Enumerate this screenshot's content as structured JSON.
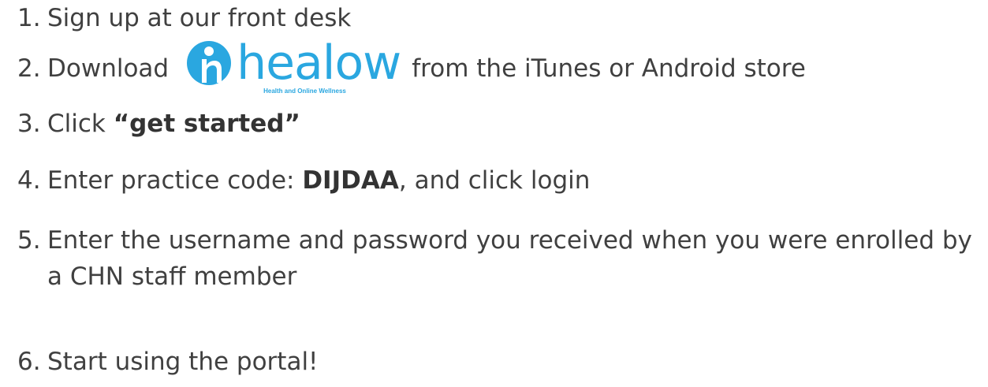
{
  "steps": [
    {
      "num": "1.",
      "text": "Sign up at our front desk"
    },
    {
      "num": "2.",
      "before": "Download",
      "after": "from the iTunes or Android store"
    },
    {
      "num": "3.",
      "before": "Click ",
      "bold": "“get started”"
    },
    {
      "num": "4.",
      "before": "Enter practice code: ",
      "bold": "DIJDAA",
      "after": ", and click login"
    },
    {
      "num": "5.",
      "line1": "Enter the username and password you received when you were enrolled by",
      "line2": "a CHN staff member"
    },
    {
      "num": "6.",
      "text": "Start using the portal!"
    }
  ],
  "logo": {
    "wordmark": "healow",
    "tagline": "Health and Online Wellness",
    "color": "#2aa7e0"
  },
  "colors": {
    "text": "#404040"
  }
}
